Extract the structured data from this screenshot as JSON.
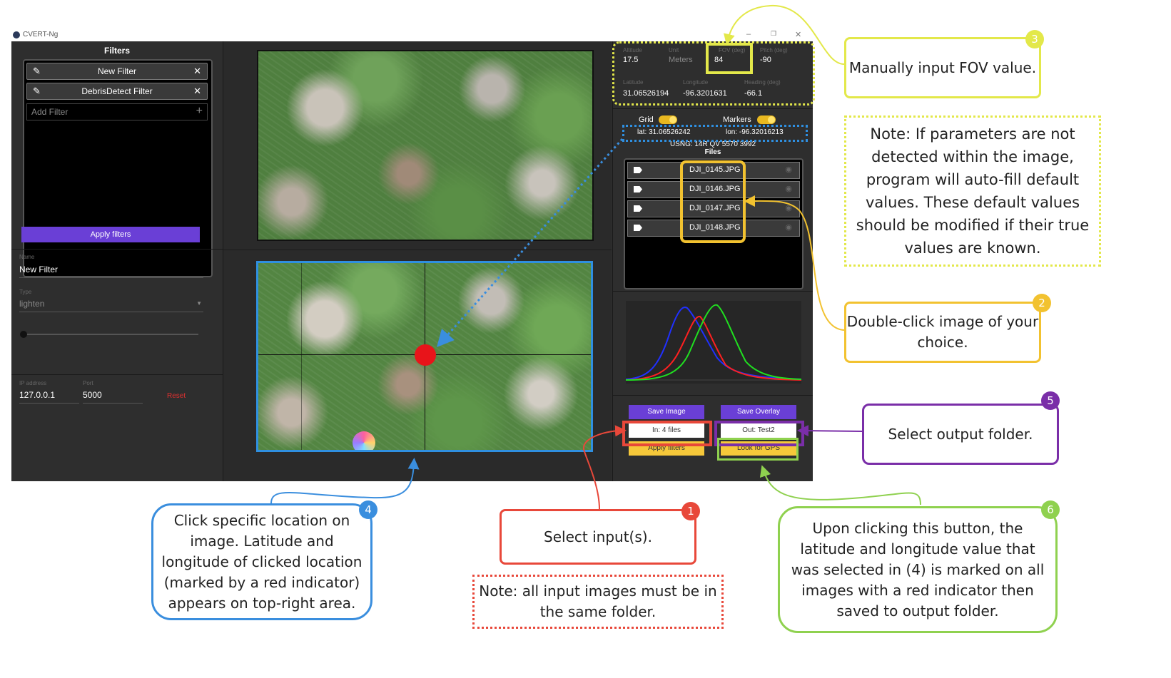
{
  "window": {
    "title": "CVERT-Ng",
    "minimize": "–",
    "maximize": "❐",
    "close": "✕"
  },
  "filters": {
    "title": "Filters",
    "items": [
      {
        "label": "New Filter"
      },
      {
        "label": "DebrisDetect Filter"
      }
    ],
    "add_placeholder": "Add Filter",
    "apply_label": "Apply filters"
  },
  "editor": {
    "name_label": "Name",
    "name_value": "New Filter",
    "type_label": "Type",
    "type_value": "lighten",
    "slider_value": 0
  },
  "network": {
    "ip_label": "IP address",
    "ip_value": "127.0.0.1",
    "port_label": "Port",
    "port_value": "5000",
    "reset_label": "Reset"
  },
  "params": {
    "altitude_label": "Altitude",
    "altitude_value": "17.5",
    "unit_label": "Unit",
    "unit_value": "Meters",
    "fov_label": "FOV (deg)",
    "fov_value": "84",
    "pitch_label": "Pitch (deg)",
    "pitch_value": "-90",
    "latitude_label": "Latitude",
    "latitude_value": "31.06526194",
    "longitude_label": "Longitude",
    "longitude_value": "-96.3201631",
    "heading_label": "Heading (deg)",
    "heading_value": "-66.1"
  },
  "toggles": {
    "grid_label": "Grid",
    "markers_label": "Markers"
  },
  "coords": {
    "lat": "lat: 31.06526242",
    "lon": "lon: -96.32016213",
    "usng": "USNG: 14R QV 5570 3992"
  },
  "files": {
    "title": "Files",
    "items": [
      {
        "name": "DJI_0145.JPG"
      },
      {
        "name": "DJI_0146.JPG"
      },
      {
        "name": "DJI_0147.JPG"
      },
      {
        "name": "DJI_0148.JPG"
      }
    ]
  },
  "actions": {
    "save_image": "Save Image",
    "input_files": "In: 4 files",
    "apply_filters": "Apply filters",
    "save_overlay": "Save Overlay",
    "output_folder": "Out: Test2",
    "look_gps": "Look for GPS"
  },
  "annotations": {
    "c1": {
      "num": "1",
      "text": "Select input(s)."
    },
    "c2": {
      "num": "2",
      "text": "Double-click image of your choice."
    },
    "c3": {
      "num": "3",
      "text": "Manually input FOV value."
    },
    "c4": {
      "num": "4",
      "text": "Click specific location on image. Latitude and longitude of clicked location (marked by a red indicator) appears on top-right area."
    },
    "c5": {
      "num": "5",
      "text": "Select output folder."
    },
    "c6": {
      "num": "6",
      "text": "Upon clicking this button, the latitude and longitude value that was selected in (4) is marked on all images with a red indicator then saved to output folder."
    },
    "note_defaults": "Note: If parameters are not detected within the image, program will auto-fill default values. These default values should be modified if their true values are known.",
    "note_folder": "Note: all input images must be in the same folder."
  },
  "colors": {
    "blue": "#3a8ede",
    "red": "#e8483a",
    "yellow": "#f2c230",
    "lime": "#e3e84a",
    "purple": "#7a2ea8",
    "green": "#8fd14f",
    "accent_button": "#6a3fd6"
  }
}
